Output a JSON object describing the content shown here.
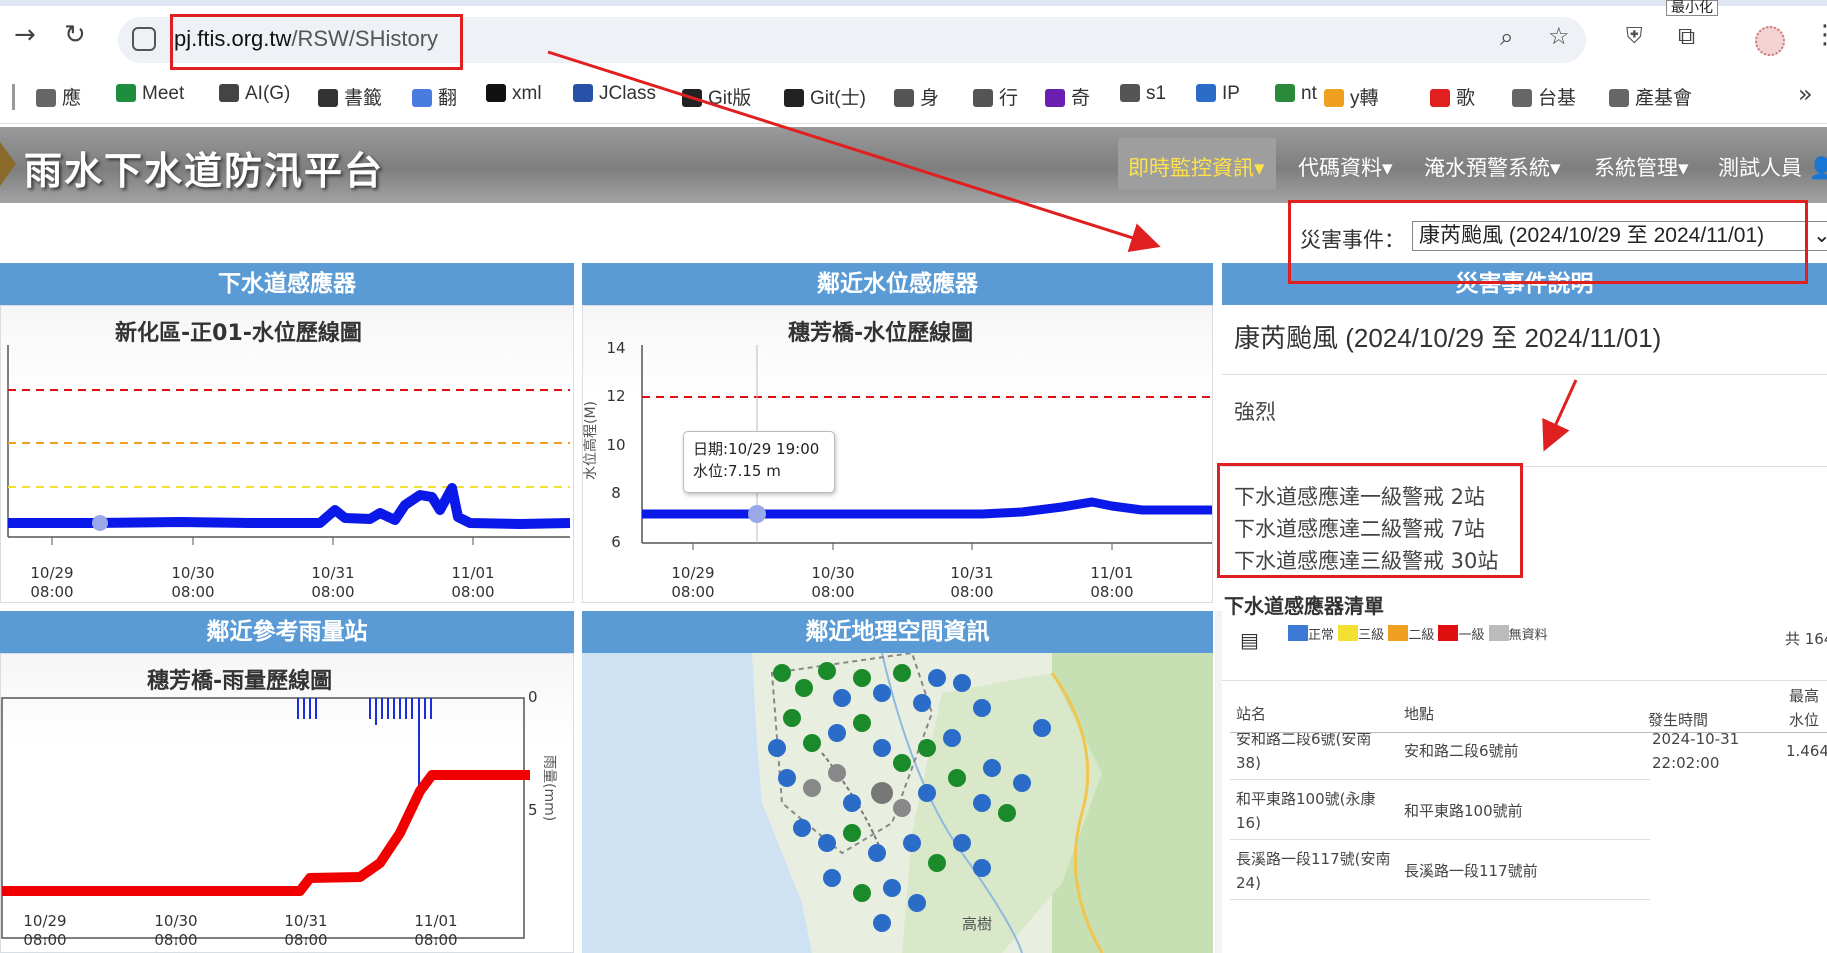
{
  "browser": {
    "url_host": "pj.ftis.org.tw",
    "url_path": "/RSW/SHistory",
    "tooltip": "最小化"
  },
  "bookmarks": [
    "應",
    "Meet",
    "AI(G)",
    "書籤",
    "翻",
    "xml",
    "JClass",
    "Git版",
    "Git(士)",
    "身",
    "行",
    "奇",
    "s1",
    "IP",
    "nt",
    "y轉",
    "歌",
    "台基",
    "產基會"
  ],
  "app": {
    "title": "雨水下水道防汛平台",
    "menu": [
      "即時監控資訊",
      "代碼資料",
      "淹水預警系統",
      "系統管理",
      "測試人員"
    ]
  },
  "event_selector": {
    "label": "災害事件：",
    "value": "康芮颱風 (2024/10/29 至 2024/11/01)"
  },
  "panels": {
    "sewer": {
      "header": "下水道感應器",
      "title": "新化區-正01-水位歷線圖"
    },
    "water": {
      "header": "鄰近水位感應器",
      "title": "穗芳橋-水位歷線圖",
      "ylabel": "水位高程(M)",
      "tooltip_date": "日期:10/29 19:00",
      "tooltip_level": "水位:7.15 m"
    },
    "rain": {
      "header": "鄰近參考雨量站",
      "title": "穗芳橋-雨量歷線圖",
      "ylabel": "雨量(mm)"
    },
    "map": {
      "header": "鄰近地理空間資訊",
      "place": "高樹"
    },
    "disaster": {
      "header": "災害事件說明",
      "event_name": "康芮颱風 (2024/10/29 至 2024/11/01)",
      "intensity": "強烈",
      "alerts": [
        "下水道感應達一級警戒 2站",
        "下水道感應達二級警戒 7站",
        "下水道感應達三級警戒 30站"
      ]
    }
  },
  "sensor_list": {
    "title": "下水道感應器清單",
    "legend": [
      "正常",
      "三級",
      "二級",
      "一級",
      "無資料"
    ],
    "total": "共 164",
    "columns": [
      "站名",
      "地點",
      "發生時間",
      "最高水位"
    ],
    "rows": [
      {
        "name": "安和路二段6號(安南38)",
        "loc": "安和路二段6號前",
        "time": "2024-10-31 22:02:00",
        "max": "1.464"
      },
      {
        "name": "和平東路100號(永康16)",
        "loc": "和平東路100號前",
        "time": "",
        "max": ""
      },
      {
        "name": "長溪路一段117號(安南24)",
        "loc": "長溪路一段117號前",
        "time": "",
        "max": ""
      }
    ]
  },
  "x_ticks": [
    {
      "d": "10/29",
      "t": "08:00"
    },
    {
      "d": "10/30",
      "t": "08:00"
    },
    {
      "d": "10/31",
      "t": "08:00"
    },
    {
      "d": "11/01",
      "t": "08:00"
    }
  ],
  "water_y_ticks": [
    "14",
    "12",
    "10",
    "8",
    "6"
  ],
  "rain_y_ticks": [
    "0",
    "5"
  ],
  "chart_data": [
    {
      "type": "line",
      "title": "新化區-正01-水位歷線圖",
      "x": [
        "10/29 08:00",
        "10/30 08:00",
        "10/31 08:00",
        "11/01 08:00"
      ],
      "series": [
        {
          "values": [
            0.1,
            0.1,
            0.15,
            0.6
          ]
        }
      ],
      "thresholds": [
        "red",
        "orange",
        "yellow"
      ]
    },
    {
      "type": "line",
      "title": "穗芳橋-水位歷線圖",
      "ylabel": "水位高程(M)",
      "ylim": [
        6,
        14
      ],
      "x": [
        "10/29 08:00",
        "10/30 08:00",
        "10/31 08:00",
        "11/01 08:00"
      ],
      "series": [
        {
          "values": [
            7.15,
            7.15,
            7.15,
            7.8
          ]
        }
      ],
      "thresholds": [
        {
          "value": 12.2,
          "color": "red"
        }
      ]
    },
    {
      "type": "bar",
      "title": "穗芳橋-雨量歷線圖",
      "ylabel": "雨量(mm)",
      "x": [
        "10/29 08:00",
        "10/30 08:00",
        "10/31 08:00",
        "11/01 08:00"
      ]
    }
  ]
}
